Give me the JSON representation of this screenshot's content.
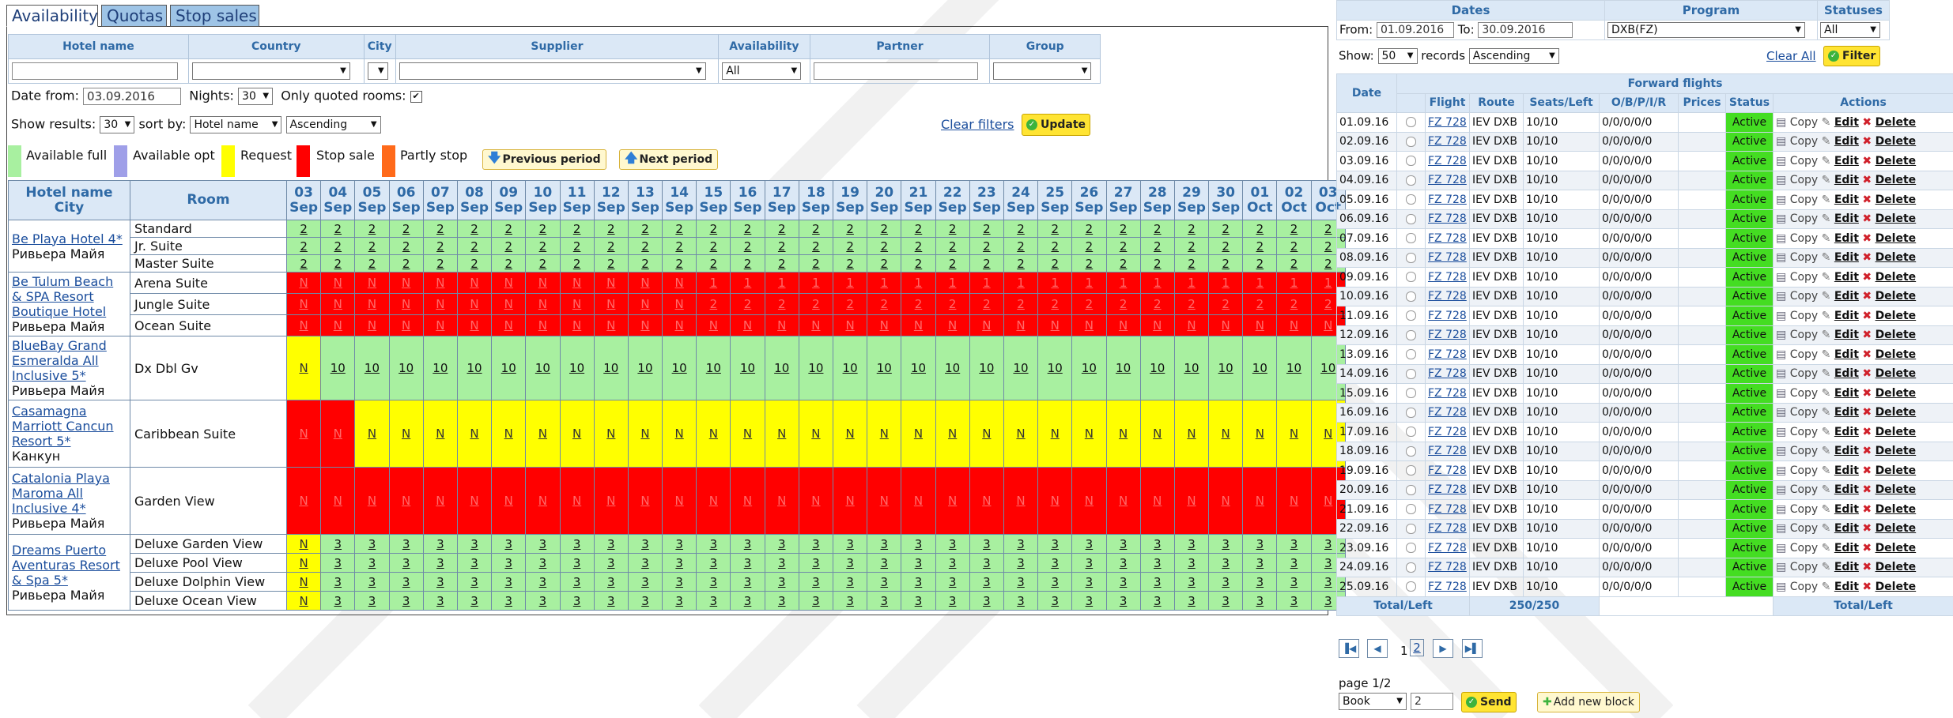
{
  "tabs": [
    {
      "label": "Availability",
      "active": true
    },
    {
      "label": "Quotas",
      "active": false
    },
    {
      "label": "Stop sales",
      "active": false
    }
  ],
  "filters": {
    "headers": [
      "Hotel name",
      "Country",
      "City",
      "Supplier",
      "Availability",
      "Partner",
      "Group"
    ],
    "availability_value": "All",
    "date_from_label": "Date from:",
    "date_from_value": "03.09.2016",
    "nights_label": "Nights:",
    "nights_value": "30",
    "only_quoted_label": "Only quoted rooms:",
    "only_quoted_checked": true,
    "show_results_label": "Show results:",
    "show_results_value": "30",
    "sort_by_label": "sort by:",
    "sort_by_value": "Hotel name",
    "order_value": "Ascending",
    "clear_filters": "Clear filters",
    "update_label": "Update"
  },
  "legend": {
    "items": [
      {
        "label": "Available full",
        "color": "#a8f0a0"
      },
      {
        "label": "Available opt",
        "color": "#9f9fe8"
      },
      {
        "label": "Request",
        "color": "#ffff00"
      },
      {
        "label": "Stop sale",
        "color": "#ff0000"
      },
      {
        "label": "Partly stop",
        "color": "#ff6a1a"
      }
    ],
    "prev_period": "Previous period",
    "next_period": "Next period"
  },
  "availability": {
    "header_hotel": "Hotel name",
    "header_city": "City",
    "header_room": "Room",
    "dates": [
      {
        "d": "03",
        "m": "Sep"
      },
      {
        "d": "04",
        "m": "Sep"
      },
      {
        "d": "05",
        "m": "Sep"
      },
      {
        "d": "06",
        "m": "Sep"
      },
      {
        "d": "07",
        "m": "Sep"
      },
      {
        "d": "08",
        "m": "Sep"
      },
      {
        "d": "09",
        "m": "Sep"
      },
      {
        "d": "10",
        "m": "Sep"
      },
      {
        "d": "11",
        "m": "Sep"
      },
      {
        "d": "12",
        "m": "Sep"
      },
      {
        "d": "13",
        "m": "Sep"
      },
      {
        "d": "14",
        "m": "Sep"
      },
      {
        "d": "15",
        "m": "Sep"
      },
      {
        "d": "16",
        "m": "Sep"
      },
      {
        "d": "17",
        "m": "Sep"
      },
      {
        "d": "18",
        "m": "Sep"
      },
      {
        "d": "19",
        "m": "Sep"
      },
      {
        "d": "20",
        "m": "Sep"
      },
      {
        "d": "21",
        "m": "Sep"
      },
      {
        "d": "22",
        "m": "Sep"
      },
      {
        "d": "23",
        "m": "Sep"
      },
      {
        "d": "24",
        "m": "Sep"
      },
      {
        "d": "25",
        "m": "Sep"
      },
      {
        "d": "26",
        "m": "Sep"
      },
      {
        "d": "27",
        "m": "Sep"
      },
      {
        "d": "28",
        "m": "Sep"
      },
      {
        "d": "29",
        "m": "Sep"
      },
      {
        "d": "30",
        "m": "Sep"
      },
      {
        "d": "01",
        "m": "Oct"
      },
      {
        "d": "02",
        "m": "Oct"
      },
      {
        "d": "03",
        "m": "Oct"
      }
    ],
    "hotels": [
      {
        "name": "Be Playa Hotel 4*",
        "city": "Ривьера Майя",
        "tall": false,
        "rooms": [
          {
            "name": "Standard",
            "cells": "2:g*31"
          },
          {
            "name": "Jr. Suite",
            "cells": "2:g*31"
          },
          {
            "name": "Master Suite",
            "cells": "2:g*31"
          }
        ]
      },
      {
        "name": "Be Tulum Beach & SPA Resort Boutique Hotel",
        "city": "Ривьера Майя",
        "tall": false,
        "rooms": [
          {
            "name": "Arena Suite",
            "cells": "N:r*12,1:r*19"
          },
          {
            "name": "Jungle Suite",
            "cells": "N:r*12,2:r*19"
          },
          {
            "name": "Ocean Suite",
            "cells": "N:r*31"
          }
        ]
      },
      {
        "name": "BlueBay Grand Esmeralda All Inclusive 5*",
        "city": "Ривьера Майя",
        "tall": true,
        "rooms": [
          {
            "name": "Dx Dbl Gv",
            "cells": "N:y*1,10:g*30"
          }
        ]
      },
      {
        "name": "Casamagna Marriott Cancun Resort 5*",
        "city": "Канкун",
        "tall": true,
        "rooms": [
          {
            "name": "Caribbean Suite",
            "cells": "N:r*2,N:y*29"
          }
        ]
      },
      {
        "name": "Catalonia Playa Maroma All Inclusive 4*",
        "city": "Ривьера Майя",
        "tall": true,
        "rooms": [
          {
            "name": "Garden View",
            "cells": "N:r*31"
          }
        ]
      },
      {
        "name": "Dreams Puerto Aventuras Resort & Spa 5*",
        "city": "Ривьера Майя",
        "tall": false,
        "rooms": [
          {
            "name": "Deluxe Garden View",
            "cells": "N:y*1,3:g*30"
          },
          {
            "name": "Deluxe Pool View",
            "cells": "N:y*1,3:g*30"
          },
          {
            "name": "Deluxe Dolphin View",
            "cells": "N:y*1,3:g*30"
          },
          {
            "name": "Deluxe Ocean View",
            "cells": "N:y*1,3:g*30"
          }
        ]
      }
    ]
  },
  "flights_filter": {
    "headers": [
      "Dates",
      "Program",
      "Statuses"
    ],
    "from_label": "From:",
    "from_value": "01.09.2016",
    "to_label": "To:",
    "to_value": "30.09.2016",
    "program_value": "DXB(FZ)",
    "statuses_value": "All",
    "show_label": "Show:",
    "show_value": "50",
    "records_label": "records",
    "order_value": "Ascending",
    "clear_all": "Clear All",
    "filter_label": "Filter"
  },
  "flights": {
    "group_header": "Forward flights",
    "headers": {
      "date": "Date",
      "flight": "Flight",
      "route": "Route",
      "seats": "Seats/Left",
      "obpir": "O/B/P/I/R",
      "prices": "Prices",
      "status": "Status",
      "actions": "Actions"
    },
    "rows": [
      {
        "date": "01.09.16"
      },
      {
        "date": "02.09.16"
      },
      {
        "date": "03.09.16"
      },
      {
        "date": "04.09.16"
      },
      {
        "date": "05.09.16"
      },
      {
        "date": "06.09.16"
      },
      {
        "date": "07.09.16"
      },
      {
        "date": "08.09.16"
      },
      {
        "date": "09.09.16"
      },
      {
        "date": "10.09.16"
      },
      {
        "date": "11.09.16"
      },
      {
        "date": "12.09.16"
      },
      {
        "date": "13.09.16"
      },
      {
        "date": "14.09.16"
      },
      {
        "date": "15.09.16"
      },
      {
        "date": "16.09.16"
      },
      {
        "date": "17.09.16"
      },
      {
        "date": "18.09.16"
      },
      {
        "date": "19.09.16"
      },
      {
        "date": "20.09.16"
      },
      {
        "date": "21.09.16"
      },
      {
        "date": "22.09.16"
      },
      {
        "date": "23.09.16"
      },
      {
        "date": "24.09.16"
      },
      {
        "date": "25.09.16"
      }
    ],
    "flight": "FZ 728",
    "route": "IEV DXB",
    "seats": "10/10",
    "obpir": "0/0/0/0/0",
    "prices": "",
    "status": "Active",
    "copy": "Copy",
    "edit": "Edit",
    "delete": "Delete",
    "total_label": "Total/Left",
    "total_value": "250/250",
    "total_label_right": "Total/Left"
  },
  "pagination": {
    "pages": [
      "1",
      "2"
    ],
    "page_info": "page 1/2",
    "action_value": "Book",
    "count_value": "2",
    "send_label": "Send",
    "add_block_label": "Add new block"
  }
}
